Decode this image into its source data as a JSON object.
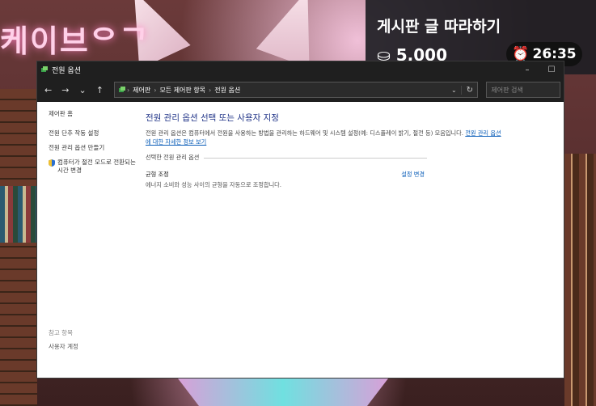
{
  "background": {
    "neon_text": "케이브ᄋᄀ",
    "overlay_card": {
      "badge": "",
      "cut_text": "",
      "title": "게시판 글 따라하기",
      "amount": "5,000"
    },
    "timer": "26:35"
  },
  "window": {
    "title": "전원 옵션",
    "controls": {
      "minimize": "–",
      "maximize": "☐"
    },
    "nav": {
      "back": "←",
      "forward": "→",
      "history": "⌄",
      "up": "↑"
    },
    "breadcrumb": [
      "제어판",
      "모든 제어판 항목",
      "전원 옵션"
    ],
    "search_placeholder": "제어판 검색",
    "sidebar": {
      "home": "제어판 홈",
      "links": [
        "전원 단추 작동 설정",
        "전원 관리 옵션 만들기",
        "컴퓨터가 절전 모드로 전환되는 시간 변경"
      ],
      "see_also_label": "참고 항목",
      "see_also_links": [
        "사용자 계정"
      ]
    },
    "main": {
      "heading": "전원 관리 옵션 선택 또는 사용자 지정",
      "desc_text": "전원 관리 옵션은 컴퓨터에서 전원을 사용하는 방법을 관리하는 하드웨어 및 시스템 설정(예: 디스플레이 밝기, 절전 등) 모음입니다.",
      "desc_link": "전원 관리 옵션에 대한 자세한 정보 보기",
      "section_label": "선택한 전원 관리 옵션",
      "plan_name": "균형 조정",
      "plan_desc": "에너지 소비와 성능 사이의 균형을 자동으로 조정합니다.",
      "plan_change": "설정 변경"
    }
  },
  "colors": {
    "accent_link": "#0a5db8",
    "heading": "#1e3287",
    "chrome": "#1f1f1f"
  }
}
